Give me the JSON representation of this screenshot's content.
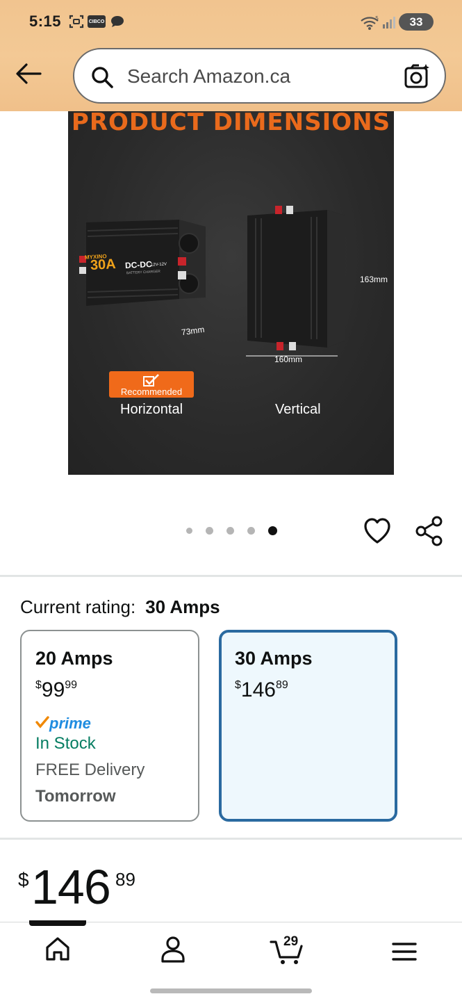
{
  "status_bar": {
    "time": "5:15",
    "carrier_badge": "CIBCO",
    "battery": "33",
    "icons": [
      "screenshot-icon",
      "cibc-icon",
      "chat-bubble-icon",
      "wifi-icon",
      "signal-icon",
      "battery-icon"
    ]
  },
  "header": {
    "back_icon": "back-arrow-icon",
    "search_placeholder": "Search Amazon.ca",
    "search_icon": "search-icon",
    "camera_icon": "camera-lens-icon"
  },
  "product_image": {
    "title": "PRODUCT DIMENSIONS",
    "unit_label_brand": "MYXINO",
    "unit_label_amps": "30A",
    "unit_label_type": "DC-DC",
    "unit_label_sub": "12V-12V",
    "unit_label_caption": "BATTERY CHARGER",
    "dim_depth": "73mm",
    "dim_width": "160mm",
    "dim_height": "163mm",
    "badge": "Recommended",
    "orientation_left": "Horizontal",
    "orientation_right": "Vertical"
  },
  "carousel": {
    "count": 5,
    "active_index": 4
  },
  "actions": {
    "wishlist_icon": "heart-icon",
    "share_icon": "share-icon"
  },
  "variant": {
    "label": "Current rating:",
    "selected_value": "30 Amps",
    "options": [
      {
        "name": "20 Amps",
        "currency": "$",
        "price_whole": "99",
        "price_fraction": "99",
        "prime": "prime",
        "stock": "In Stock",
        "delivery": "FREE Delivery",
        "delivery_day": "Tomorrow",
        "selected": false
      },
      {
        "name": "30 Amps",
        "currency": "$",
        "price_whole": "146",
        "price_fraction": "89",
        "selected": true
      }
    ]
  },
  "price": {
    "currency": "$",
    "whole": "146",
    "fraction": "89"
  },
  "bottom_nav": {
    "items": [
      "home-icon",
      "account-icon",
      "cart-icon",
      "menu-icon"
    ],
    "cart_count": "29",
    "active_index": 0
  },
  "colors": {
    "header_bg": "#f3c995",
    "selected_border": "#2a6aa0",
    "selected_bg": "#eef8fd",
    "in_stock": "#067d62",
    "prime_blue": "#1f8ce0",
    "title_orange": "#e96a1c"
  }
}
